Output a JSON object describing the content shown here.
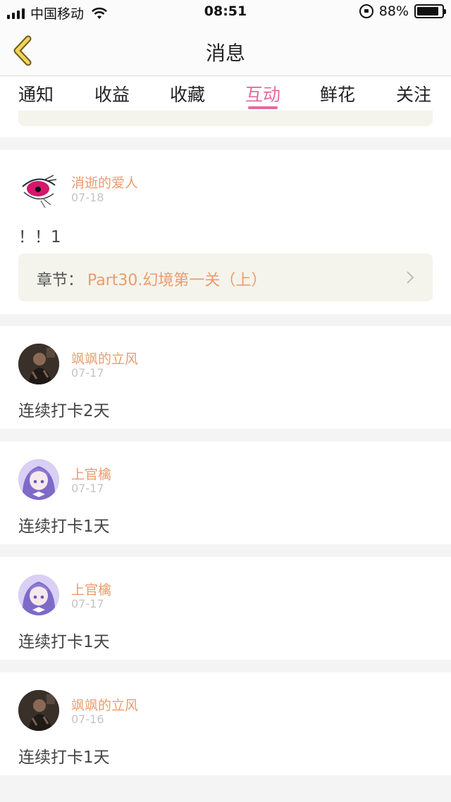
{
  "status_bar": {
    "carrier": "中国移动",
    "time": "08:51",
    "battery_percent": "88%",
    "battery_level": 0.88
  },
  "nav": {
    "title": "消息"
  },
  "tabs": [
    {
      "label": "通知",
      "active": false
    },
    {
      "label": "收益",
      "active": false
    },
    {
      "label": "收藏",
      "active": false
    },
    {
      "label": "互动",
      "active": true
    },
    {
      "label": "鲜花",
      "active": false
    },
    {
      "label": "关注",
      "active": false
    }
  ],
  "messages": [
    {
      "username": "消逝的爱人",
      "date": "07-18",
      "content": "！！1",
      "chapter_label": "章节：",
      "chapter_value": "Part30.幻境第一关（上）",
      "avatar": "eye-avatar"
    },
    {
      "username": "飒飒的立风",
      "date": "07-17",
      "content": "连续打卡2天",
      "avatar": "dark-portrait-avatar"
    },
    {
      "username": "上官檎",
      "date": "07-17",
      "content": "连续打卡1天",
      "avatar": "purple-anime-avatar"
    },
    {
      "username": "上官檎",
      "date": "07-17",
      "content": "连续打卡1天",
      "avatar": "purple-anime-avatar"
    },
    {
      "username": "飒飒的立风",
      "date": "07-16",
      "content": "连续打卡1天",
      "avatar": "dark-portrait-avatar"
    }
  ],
  "colors": {
    "accent_pink": "#e56aa0",
    "username_orange": "#ee9a6a",
    "back_arrow_yellow": "#f2d45a",
    "chip_bg": "#f4f4ec"
  }
}
